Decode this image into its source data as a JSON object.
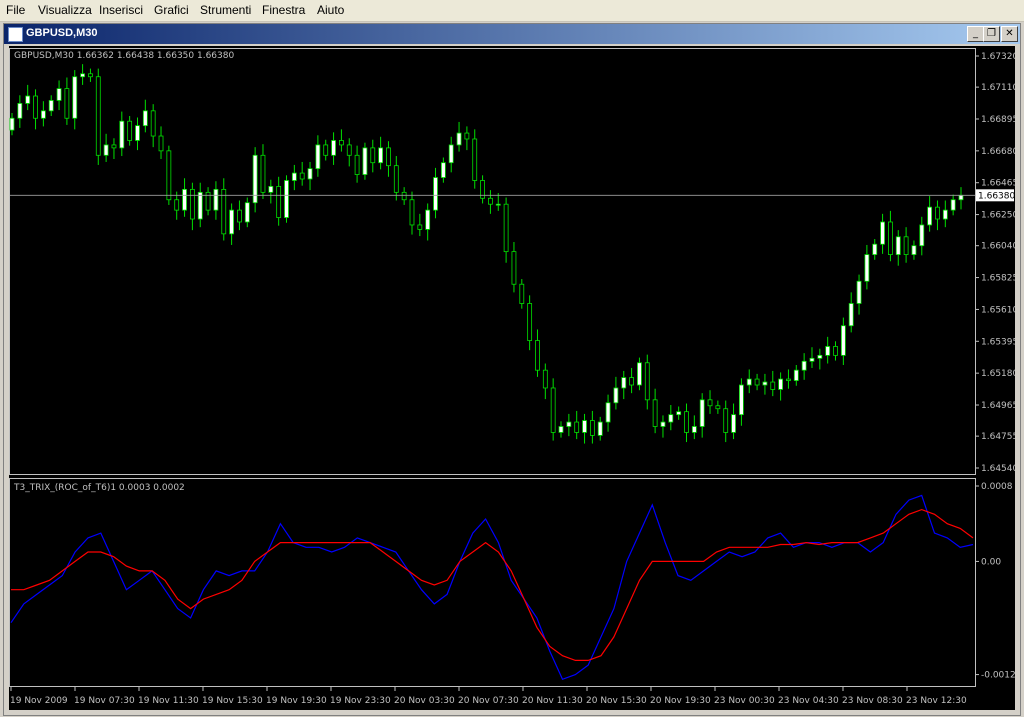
{
  "menu": [
    "File",
    "Visualizza",
    "Inserisci",
    "Grafici",
    "Strumenti",
    "Finestra",
    "Aiuto"
  ],
  "window": {
    "title": "GBPUSD,M30",
    "buttons": {
      "minimize": "_",
      "restore": "❐",
      "close": "✕"
    }
  },
  "colors": {
    "background": "#000000",
    "axis": "#c0c0c0",
    "text": "#c0c0c0",
    "bull": "#ffffff",
    "bear": "#000000",
    "wick": "#00e000",
    "candle_border": "#00e000",
    "bid_line": "#a0a0a0",
    "trix_blue": "#0000ff",
    "trix_red": "#ff0000"
  },
  "chart_data": [
    {
      "type": "candlestick",
      "title": "GBPUSD,M30  1.66362 1.66438 1.66350 1.66380",
      "ylim": [
        1.6454,
        1.6732
      ],
      "y_ticks": [
        "1.67320",
        "1.67110",
        "1.66895",
        "1.66680",
        "1.66465",
        "1.66250",
        "1.66040",
        "1.65825",
        "1.65610",
        "1.65395",
        "1.65180",
        "1.64965",
        "1.64755",
        "1.64540"
      ],
      "current_price": "1.66380",
      "current_price_value": 1.6638,
      "close": [
        1.669,
        1.67,
        1.6705,
        1.669,
        1.6695,
        1.6702,
        1.671,
        1.669,
        1.6718,
        1.672,
        1.6718,
        1.6665,
        1.6672,
        1.667,
        1.6688,
        1.6675,
        1.6685,
        1.6695,
        1.6678,
        1.6668,
        1.6635,
        1.6628,
        1.6642,
        1.6622,
        1.664,
        1.6628,
        1.6642,
        1.6612,
        1.6628,
        1.662,
        1.6633,
        1.6665,
        1.664,
        1.6644,
        1.6623,
        1.6648,
        1.6653,
        1.6649,
        1.6656,
        1.6672,
        1.6665,
        1.6675,
        1.6672,
        1.6665,
        1.6652,
        1.667,
        1.666,
        1.667,
        1.6658,
        1.664,
        1.6635,
        1.6618,
        1.6615,
        1.6628,
        1.665,
        1.666,
        1.6672,
        1.668,
        1.6676,
        1.6648,
        1.6636,
        1.6632,
        1.6632,
        1.66,
        1.6578,
        1.6565,
        1.654,
        1.652,
        1.6508,
        1.6478,
        1.6482,
        1.6485,
        1.6478,
        1.6486,
        1.6476,
        1.6485,
        1.6498,
        1.6508,
        1.6515,
        1.651,
        1.6525,
        1.65,
        1.6482,
        1.6485,
        1.649,
        1.6492,
        1.6478,
        1.6482,
        1.65,
        1.6496,
        1.6494,
        1.6478,
        1.649,
        1.651,
        1.6514,
        1.651,
        1.6512,
        1.6507,
        1.6514,
        1.6513,
        1.652,
        1.6526,
        1.6528,
        1.653,
        1.6536,
        1.653,
        1.655,
        1.6565,
        1.658,
        1.6598,
        1.6605,
        1.662,
        1.6598,
        1.661,
        1.6598,
        1.6604,
        1.6618,
        1.663,
        1.6622,
        1.6628,
        1.6635,
        1.6638
      ]
    },
    {
      "type": "line",
      "title": "T3_TRIX_(ROC_of_T6)1 0.0003 0.0002",
      "ylim": [
        -0.0013,
        0.0008
      ],
      "y_ticks": [
        "0.0008",
        "0.00",
        "-0.0012"
      ],
      "x_ticks": [
        "19 Nov 2009",
        "19 Nov 07:30",
        "19 Nov 11:30",
        "19 Nov 15:30",
        "19 Nov 19:30",
        "19 Nov 23:30",
        "20 Nov 03:30",
        "20 Nov 07:30",
        "20 Nov 11:30",
        "20 Nov 15:30",
        "20 Nov 19:30",
        "23 Nov 00:30",
        "23 Nov 04:30",
        "23 Nov 08:30",
        "23 Nov 12:30"
      ],
      "series": [
        {
          "color": "blue",
          "values": [
            -0.00065,
            -0.00045,
            -0.00035,
            -0.00025,
            -0.00015,
            0.0001,
            0.00025,
            0.0003,
            0.0,
            -0.0003,
            -0.0002,
            -0.0001,
            -0.0003,
            -0.0005,
            -0.0006,
            -0.0003,
            -0.0001,
            -0.00015,
            -0.0001,
            -0.0001,
            0.0001,
            0.0004,
            0.0002,
            0.00015,
            0.00015,
            0.0001,
            0.00015,
            0.00025,
            0.0002,
            0.00015,
            0.0001,
            -0.0001,
            -0.0003,
            -0.00045,
            -0.00035,
            0.0,
            0.0003,
            0.00045,
            0.0002,
            -0.0002,
            -0.0004,
            -0.0006,
            -0.00095,
            -0.00125,
            -0.0012,
            -0.0011,
            -0.0008,
            -0.0005,
            0.0,
            0.0003,
            0.0006,
            0.0002,
            -0.00015,
            -0.0002,
            -0.0001,
            0.0,
            0.0001,
            5e-05,
            0.0001,
            0.00025,
            0.0003,
            0.00015,
            0.0002,
            0.0002,
            0.00015,
            0.0002,
            0.0002,
            0.0001,
            0.0002,
            0.0005,
            0.00065,
            0.0007,
            0.0003,
            0.00025,
            0.00015,
            0.00018
          ]
        },
        {
          "color": "red",
          "values": [
            -0.0003,
            -0.0003,
            -0.00025,
            -0.0002,
            -0.0001,
            0.0,
            0.0001,
            0.0001,
            5e-05,
            -5e-05,
            -0.0001,
            -0.0001,
            -0.0002,
            -0.0004,
            -0.0005,
            -0.0004,
            -0.00035,
            -0.0003,
            -0.0002,
            0.0,
            0.0001,
            0.0002,
            0.0002,
            0.0002,
            0.0002,
            0.0002,
            0.0002,
            0.0002,
            0.0002,
            0.0001,
            0.0,
            -0.0001,
            -0.0002,
            -0.00025,
            -0.0002,
            0.0,
            0.0001,
            0.0002,
            0.0001,
            -0.0001,
            -0.0004,
            -0.0007,
            -0.0009,
            -0.001,
            -0.00105,
            -0.00105,
            -0.001,
            -0.0008,
            -0.0005,
            -0.0002,
            0.0,
            0.0,
            0.0,
            0.0,
            0.0,
            0.0001,
            0.00015,
            0.00015,
            0.00015,
            0.00015,
            0.00018,
            0.00018,
            0.0002,
            0.00018,
            0.0002,
            0.0002,
            0.0002,
            0.00025,
            0.0003,
            0.0004,
            0.0005,
            0.00055,
            0.0005,
            0.0004,
            0.00035,
            0.00025
          ]
        }
      ]
    }
  ]
}
